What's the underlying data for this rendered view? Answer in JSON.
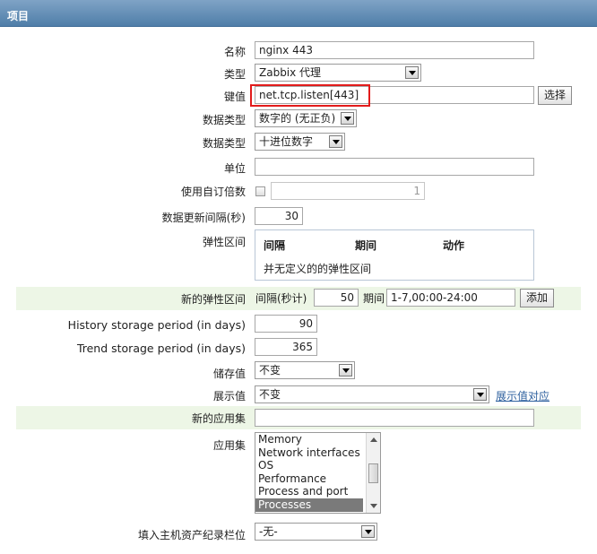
{
  "header": {
    "title": "项目"
  },
  "form": {
    "name": {
      "label": "名称",
      "value": "nginx 443"
    },
    "type": {
      "label": "类型",
      "value": "Zabbix 代理"
    },
    "key": {
      "label": "键值",
      "value": "net.tcp.listen[443]",
      "select_button": "选择"
    },
    "data_type": {
      "label": "数据类型",
      "value": "数字的 (无正负)"
    },
    "data_format": {
      "label": "数据类型",
      "value": "十进位数字"
    },
    "units": {
      "label": "单位",
      "value": ""
    },
    "multiplier": {
      "label": "使用自订倍数",
      "checked": false,
      "value": "1"
    },
    "update_interval": {
      "label": "数据更新间隔(秒)",
      "value": "30"
    },
    "flex_intervals": {
      "label": "弹性区间",
      "col_interval": "间隔",
      "col_period": "期间",
      "col_action": "动作",
      "empty_message": "并无定义的的弹性区间"
    },
    "new_flex": {
      "label": "新的弹性区间",
      "interval_label": "间隔(秒计)",
      "interval_value": "50",
      "period_label": "期间",
      "period_value": "1-7,00:00-24:00",
      "add_button": "添加"
    },
    "history": {
      "label": "History storage period (in days)",
      "value": "90"
    },
    "trends": {
      "label": "Trend storage period (in days)",
      "value": "365"
    },
    "store_value": {
      "label": "储存值",
      "value": "不变"
    },
    "show_value": {
      "label": "展示值",
      "value": "不变",
      "link": "展示值对应"
    },
    "new_application": {
      "label": "新的应用集",
      "value": ""
    },
    "applications": {
      "label": "应用集",
      "items": [
        "Memory",
        "Network interfaces",
        "OS",
        "Performance",
        "Process and port",
        "Processes"
      ],
      "selected": "Processes"
    },
    "inventory": {
      "label": "填入主机资产纪录栏位",
      "value": "-无-"
    }
  }
}
